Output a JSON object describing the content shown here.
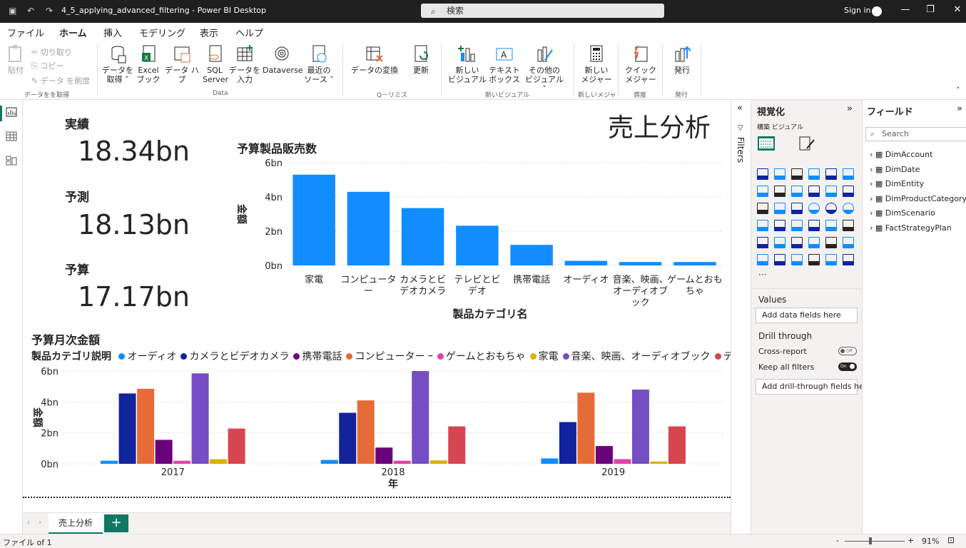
{
  "titlebar": {
    "title": "4_5_applying_advanced_filtering - Power BI Desktop",
    "search_placeholder": "検索",
    "signin": "Sign in"
  },
  "menu": {
    "tabs": [
      "ファイル",
      "ホーム",
      "挿入",
      "モデリング",
      "表示",
      "ヘルプ"
    ],
    "active_index": 1
  },
  "ribbon": {
    "paste": "貼付",
    "cut": "切り取り",
    "copy": "コピー",
    "format_painter": "データ を刷度",
    "clipboard_group": "データをを取得",
    "get_data": "データを\n取得",
    "excel": "Excel\nブック",
    "data_hub": "データ ハブ",
    "sql": "SQL\nServer",
    "enter_data": "データを\n入力",
    "dataverse": "Dataverse",
    "recent_sources": "最近の\nソース",
    "data_group": "Data",
    "transform": "データの変換",
    "refresh": "更新",
    "queries_group": "Q－リミス",
    "new_visual": "新しい\nビジュアル",
    "text_box": "テキスト\nボックス",
    "more_visuals": "その他の\nビジュアル",
    "insert_group": "新いビジュアル",
    "new_measure": "新しい\nメジャー",
    "calc_group": "新しいメジャ",
    "quick_measure": "クイック\nメジャー",
    "sensitivity_group": "感度",
    "publish": "発行",
    "share_group": "発行"
  },
  "report": {
    "title": "売上分析",
    "kpis": [
      {
        "label": "実績",
        "value": "18.34bn"
      },
      {
        "label": "予測",
        "value": "18.13bn"
      },
      {
        "label": "予算",
        "value": "17.17bn"
      }
    ]
  },
  "chart_data": [
    {
      "type": "bar",
      "title": "予算製品販売数",
      "xlabel": "製品カテゴリ名",
      "ylabel": "金額",
      "categories": [
        "家電",
        "コンピューター",
        "カメラとビデオカメラ",
        "テレビとビデオ",
        "携帯電話",
        "オーディオ",
        "音楽、映画、オーディオブック",
        "ゲームとおもちゃ"
      ],
      "category_lines": [
        [
          "家電"
        ],
        [
          "コンピュータ",
          "ー"
        ],
        [
          "カメラとビ",
          "デオカメラ"
        ],
        [
          "テレビとビ",
          "デオ"
        ],
        [
          "携帯電話"
        ],
        [
          "オーディオ"
        ],
        [
          "音楽、映画、",
          "オーディオブ",
          "ック"
        ],
        [
          "ゲームとおも",
          "ちゃ"
        ]
      ],
      "values": [
        5.3,
        4.3,
        3.35,
        2.32,
        1.2,
        0.27,
        0.2,
        0.2
      ],
      "ylim": [
        0,
        6
      ],
      "yticks": [
        "0bn",
        "2bn",
        "4bn",
        "6bn"
      ],
      "grid": true,
      "color": "#118DFF"
    },
    {
      "type": "bar",
      "title": "予算月次金額",
      "legend_title": "製品カテゴリ説明",
      "xlabel": "年",
      "ylabel": "金額",
      "categories": [
        "2017",
        "2018",
        "2019"
      ],
      "ylim": [
        0,
        6
      ],
      "yticks": [
        "0bn",
        "2bn",
        "4bn",
        "6bn"
      ],
      "grid": true,
      "legend_position": "top-left",
      "series": [
        {
          "name": "オーディオ",
          "color": "#118DFF",
          "values": [
            0.2,
            0.25,
            0.35
          ]
        },
        {
          "name": "カメラとビデオカメラ",
          "color": "#12239E",
          "values": [
            4.55,
            3.3,
            2.7
          ]
        },
        {
          "name": "携帯電話",
          "color": "#6B007B",
          "values": [
            1.55,
            1.05,
            1.15
          ]
        },
        {
          "name": "コンピューター ｰ",
          "color": "#E66C37",
          "values": [
            4.85,
            4.1,
            4.6
          ]
        },
        {
          "name": "ゲームとおもちゃ",
          "color": "#E044A7",
          "values": [
            0.2,
            0.2,
            0.3
          ]
        },
        {
          "name": "家電",
          "color": "#D9B300",
          "values": [
            0.3,
            0.22,
            0.15
          ]
        },
        {
          "name": "音楽、映画、オーディオブック",
          "color": "#744EC2",
          "values": [
            5.85,
            6.0,
            4.8
          ]
        },
        {
          "name": "テレビとビデオ",
          "color": "#D64550",
          "values": [
            2.28,
            2.42,
            2.42
          ]
        }
      ],
      "bar_series_order": [
        0,
        1,
        3,
        2,
        4,
        6,
        5,
        7
      ]
    }
  ],
  "pages": {
    "tab": "売上分析",
    "add": "+"
  },
  "status": {
    "page": "ファイル of 1",
    "zoom": "91%"
  },
  "filters_label": "Filters",
  "viz_pane": {
    "title": "視覚化",
    "subtitle": "構築 ビジュアル",
    "values_label": "Values",
    "add_data": "Add data fields here",
    "drill_through": "Drill through",
    "cross_report": "Cross-report",
    "cross_report_state": "Off",
    "keep_filters": "Keep all filters",
    "keep_filters_state": "On",
    "add_drill": "Add drill-through fields here",
    "more": "···"
  },
  "fields_pane": {
    "title": "フィールド",
    "search_placeholder": "Search",
    "tables": [
      "DimAccount",
      "DimDate",
      "DimEntity",
      "DimProductCategory",
      "DimScenario",
      "FactStrategyPlan"
    ]
  },
  "colors": {
    "accent": "#117865",
    "bar": "#118DFF"
  }
}
